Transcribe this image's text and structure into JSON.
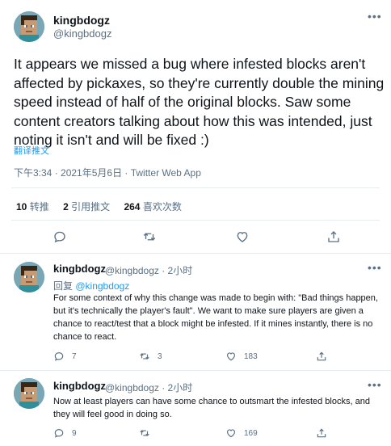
{
  "main_tweet": {
    "display_name": "kingbdogz",
    "handle": "@kingbdogz",
    "text": "It appears we missed a bug where infested blocks aren't affected by pickaxes, so they're currently double the mining speed instead of half of the original blocks. Saw some content creators talking about how this was intended, just noting it isn't and will be fixed :)",
    "translate_label": "翻译推文",
    "meta": "下午3:34 · 2021年5月6日 · Twitter Web App",
    "stats": {
      "retweets_count": "10",
      "retweets_label": "转推",
      "quotes_count": "2",
      "quotes_label": "引用推文",
      "likes_count": "264",
      "likes_label": "喜欢次数"
    },
    "more_icon": "more-dots-icon"
  },
  "replies": [
    {
      "display_name": "kingbdogz",
      "handle_time": "@kingbdogz · 2小时",
      "reply_prefix": "回复",
      "reply_to": "@kingbdogz",
      "text": "For some context of why this change was made to begin with: \"Bad things happen, but it's technically the player's fault\". We want to make sure players are given a chance to react/test that a block might be infested. If it mines instantly, there is no chance to react.",
      "reply_count": "7",
      "retweet_count": "3",
      "like_count": "183"
    },
    {
      "display_name": "kingbdogz",
      "handle_time": "@kingbdogz · 2小时",
      "text": "Now at least players can have some chance to outsmart the infested blocks, and they will feel good in doing so.",
      "reply_count": "9",
      "retweet_count": "",
      "like_count": "169"
    }
  ],
  "colors": {
    "accent": "#1d9bf0",
    "secondary_text": "#5b7083",
    "divider": "#e6ecf0"
  }
}
